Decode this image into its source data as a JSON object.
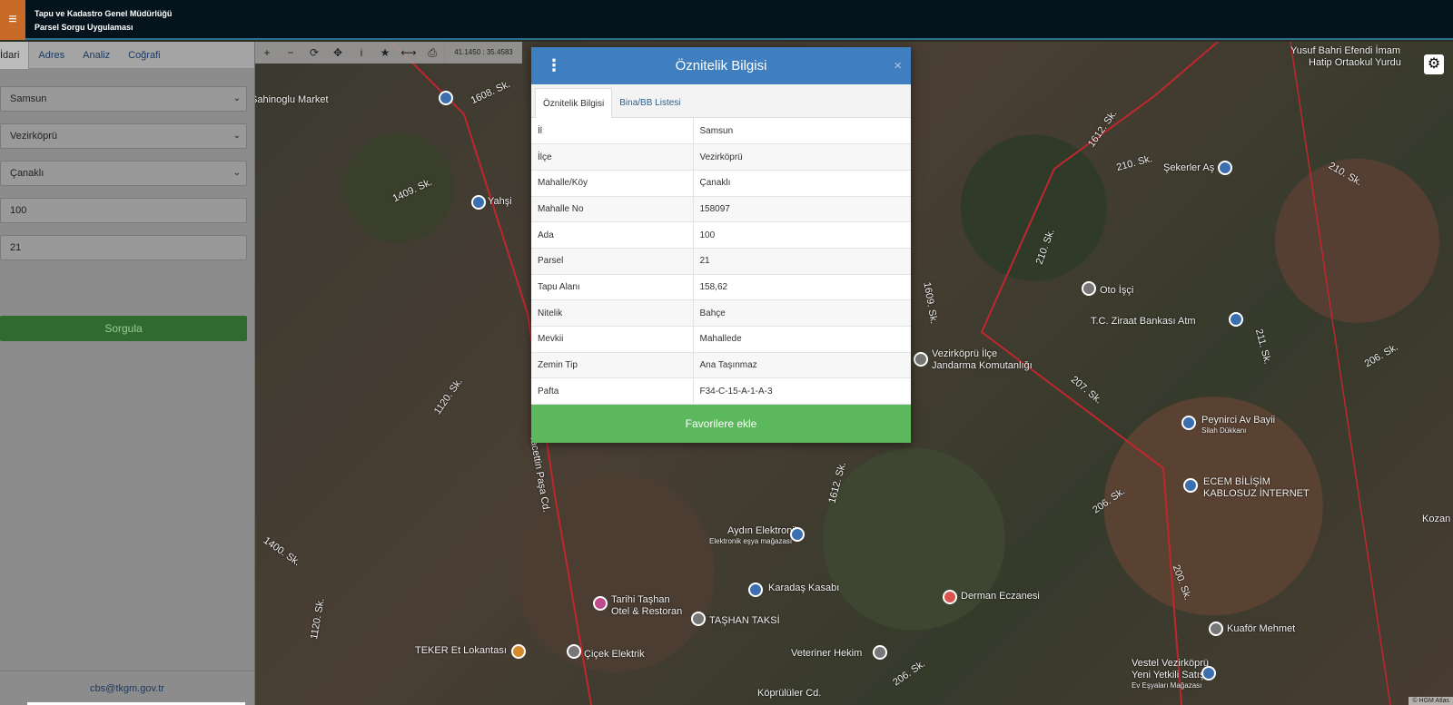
{
  "header": {
    "title_line1": "Tapu ve Kadastro Genel Müdürlüğü",
    "title_line2": "Parsel Sorgu Uygulaması",
    "menu_glyph": "≡"
  },
  "sidebar": {
    "tabs": [
      {
        "label": "İdari",
        "active": true
      },
      {
        "label": "Adres"
      },
      {
        "label": "Analiz"
      },
      {
        "label": "Coğrafi"
      }
    ],
    "fields": {
      "il": "Samsun",
      "ilce": "Vezirköprü",
      "mahalle": "Çanaklı",
      "ada": "100",
      "parsel": "21"
    },
    "query_button": "Sorgula",
    "footer_email": "cbs@tkgm.gov.tr"
  },
  "map": {
    "toolbar_icons": [
      "plus-icon",
      "minus-icon",
      "refresh-icon",
      "move-icon",
      "info-icon",
      "star-icon",
      "measure-icon",
      "print-icon"
    ],
    "toolbar_glyphs": [
      "+",
      "−",
      "⟳",
      "✥",
      "i",
      "★",
      "⟷",
      "⎙"
    ],
    "coordinates": "41.1450 : 35.4583",
    "gear_glyph": "⚙",
    "attribution": "© HGM Atlas",
    "labels": {
      "sahinoglu": "Sahinoglu Market",
      "sk1608": "1608. Sk.",
      "sk1409": "1409. Sk.",
      "yahsi": "Yahşi",
      "sk1120": "1120. Sk.",
      "tacettin": "Tacettin Paşa Cd.",
      "sk1400": "1400. Sk.",
      "sk1120b": "1120. Sk.",
      "tarihi": "Tarihi Taşhan",
      "otel": "Otel & Restoran",
      "teker": "TEKER Et Lokantası",
      "cicek": "Çiçek Elektrik",
      "tashan_taksi": "TAŞHAN TAKSİ",
      "aydin": "Aydın Elektronik",
      "aydin_sub": "Elektronik eşya mağazası",
      "karadas": "Karadaş Kasabı",
      "veteriner": "Veteriner Hekim",
      "koprululer": "Köprülüler Cd.",
      "sk1612": "1612. Sk.",
      "sk1609": "1609. Sk.",
      "jandarma1": "Vezirköprü İlçe",
      "jandarma2": "Jandarma Komutanlığı",
      "oto": "Oto İşçi",
      "ziraat": "T.C. Ziraat Bankası Atm",
      "sekerler": "Şekerler Aş",
      "sk210": "210. Sk.",
      "sk210b": "210. Sk.",
      "sk210c": "210. Sk.",
      "sk1612b": "1612. Sk.",
      "yusuf1": "Yusuf Bahri Efendi İmam",
      "yusuf2": "Hatip Ortaokul Yurdu",
      "sk211": "211. Sk.",
      "sk206": "206. Sk.",
      "sk207": "207. Sk.",
      "peynirci": "Peynirci Av Bayii",
      "silah": "Silah Dükkanı",
      "ecem1": "ECEM BİLİŞİM",
      "ecem2": "KABLOSUZ İNTERNET",
      "sk206b": "206. Sk.",
      "kozan": "Kozan",
      "derman": "Derman Eczanesi",
      "sk200": "200. Sk.",
      "kuafor": "Kuaför Mehmet",
      "vestel1": "Vestel Vezirköprü",
      "vestel2": "Yeni Yetkili Satış",
      "vestel3": "Ev Eşyaları Mağazası",
      "sk206c": "206. Sk."
    }
  },
  "modal": {
    "title": "Öznitelik Bilgisi",
    "kebab_glyph": "⋮",
    "close_glyph": "×",
    "tabs": [
      {
        "label": "Öznitelik Bilgisi",
        "active": true
      },
      {
        "label": "Bina/BB Listesi"
      }
    ],
    "rows": [
      {
        "key": "İl",
        "value": "Samsun"
      },
      {
        "key": "İlçe",
        "value": "Vezirköprü"
      },
      {
        "key": "Mahalle/Köy",
        "value": "Çanaklı"
      },
      {
        "key": "Mahalle No",
        "value": "158097"
      },
      {
        "key": "Ada",
        "value": "100"
      },
      {
        "key": "Parsel",
        "value": "21"
      },
      {
        "key": "Tapu Alanı",
        "value": "158,62"
      },
      {
        "key": "Nitelik",
        "value": "Bahçe"
      },
      {
        "key": "Mevkii",
        "value": "Mahallede"
      },
      {
        "key": "Zemin Tip",
        "value": "Ana Taşınmaz"
      },
      {
        "key": "Pafta",
        "value": "F34-C-15-A-1-A-3"
      }
    ],
    "favorite_button": "Favorilere ekle"
  },
  "colors": {
    "header_bg": "#04131c",
    "menu_accent": "#c86b28",
    "modal_header": "#3f7fbf",
    "favorite_green": "#5cb85c",
    "sorgula_green": "#2f6b2f"
  }
}
